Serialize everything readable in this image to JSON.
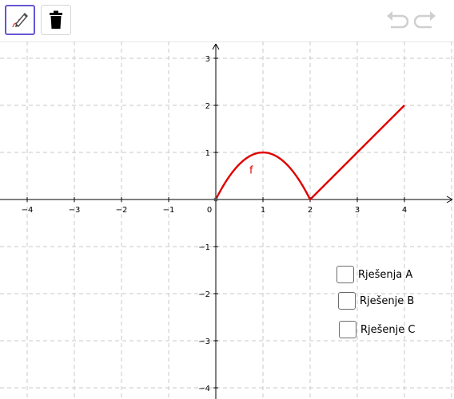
{
  "toolbar": {
    "pen_icon": "pen-icon",
    "delete_icon": "trash-icon",
    "undo_icon": "undo-icon",
    "redo_icon": "redo-icon",
    "active_tool_color": "#6557d2"
  },
  "checkboxes": [
    {
      "label": "Rješenja A",
      "checked": false
    },
    {
      "label": "Rješenje B",
      "checked": false
    },
    {
      "label": "Rješenje C",
      "checked": false
    }
  ],
  "chart_data": {
    "type": "line",
    "x_ticks": [
      "−4",
      "−3",
      "−2",
      "−1",
      "0",
      "1",
      "2",
      "3",
      "4"
    ],
    "y_ticks": [
      "−4",
      "−3",
      "−2",
      "−1",
      "1",
      "2",
      "3"
    ],
    "xlim": [
      -4.5,
      5.0
    ],
    "ylim": [
      -4.2,
      3.2
    ],
    "grid": true,
    "series": [
      {
        "name": "f",
        "color": "#e00000",
        "x": [
          0,
          0.25,
          0.5,
          0.75,
          1,
          1.25,
          1.5,
          1.75,
          2,
          3,
          4
        ],
        "y": [
          0,
          0.4375,
          0.75,
          0.9375,
          1,
          0.9375,
          0.75,
          0.4375,
          0,
          1,
          2
        ]
      }
    ]
  }
}
